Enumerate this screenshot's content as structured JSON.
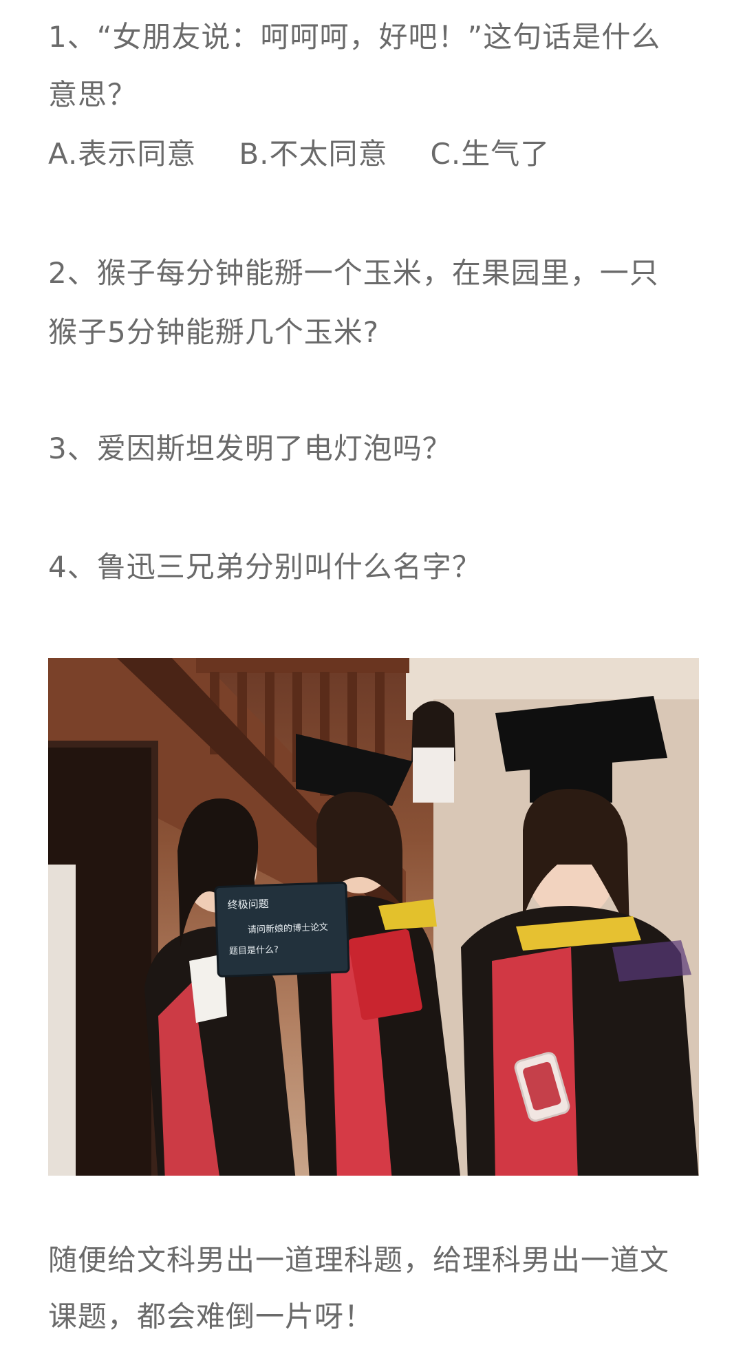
{
  "q1": {
    "line1": "1、“女朋友说：呵呵呵，好吧！”这句话是什么",
    "line2": "意思？",
    "options": [
      "A.表示同意",
      "B.不太同意",
      "C.生气了"
    ]
  },
  "q2": {
    "line1": "2、猴子每分钟能掰一个玉米，在果园里，一只",
    "line2": "猴子5分钟能掰几个玉米?"
  },
  "q3": "3、爱因斯坦发明了电灯泡吗？",
  "q4": "4、鲁迅三兄弟分别叫什么名字？",
  "photo": {
    "sign_line1": "终极问题",
    "sign_line2": "请问新娘的博士论文",
    "sign_line3": "题目是什么?"
  },
  "closing": {
    "line1": "随便给文科男出一道理科题，给理科男出一道文",
    "line2": "课题，都会难倒一片呀！"
  }
}
